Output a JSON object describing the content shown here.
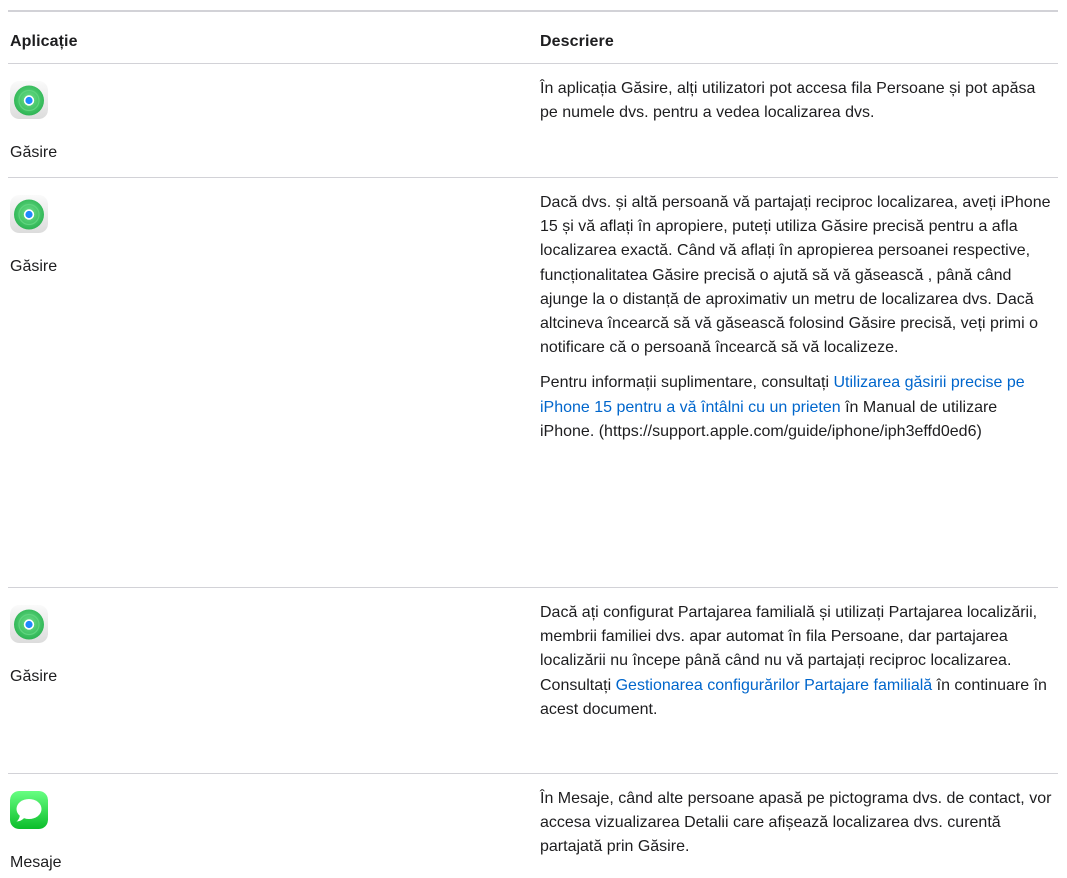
{
  "table": {
    "headers": {
      "app": "Aplicație",
      "description": "Descriere"
    },
    "rows": [
      {
        "app_name": "Găsire",
        "icon": "find-my-icon",
        "paragraphs": [
          {
            "text": "În aplicația Găsire, alți utilizatori pot accesa fila Persoane și pot apăsa pe numele dvs. pentru a vedea localizarea dvs."
          }
        ]
      },
      {
        "app_name": "Găsire",
        "icon": "find-my-icon",
        "paragraphs": [
          {
            "text": "Dacă dvs. și altă persoană vă partajați reciproc localizarea, aveți iPhone 15 și vă aflați în apropiere, puteți utiliza Găsire precisă pentru a afla localizarea exactă. Când vă aflați în apropierea persoanei respective, funcționalitatea Găsire precisă o ajută să vă găsească , până când ajunge la o distanță de aproximativ un metru de localizarea dvs. Dacă altcineva încearcă să vă găsească folosind Găsire precisă, veți primi o notificare că o persoană încearcă să vă localizeze."
          },
          {
            "before": "Pentru informații suplimentare, consultați ",
            "link": "Utilizarea găsirii precise pe iPhone 15 pentru a vă întâlni cu un prieten",
            "after": " în Manual de utilizare iPhone. (https://support.apple.com/guide/iphone/iph3effd0ed6)"
          }
        ]
      },
      {
        "app_name": "Găsire",
        "icon": "find-my-icon",
        "paragraphs": [
          {
            "before": "Dacă ați configurat Partajarea familială și utilizați Partajarea localizării, membrii familiei dvs. apar automat în fila Persoane, dar partajarea localizării nu începe până când nu vă partajați reciproc localizarea. Consultați ",
            "link": "Gestionarea configurărilor Partajare familială",
            "after": " în continuare în acest document."
          }
        ]
      },
      {
        "app_name": "Mesaje",
        "icon": "messages-icon",
        "paragraphs": [
          {
            "text": "În Mesaje, când alte persoane apasă pe pictograma dvs. de contact, vor accesa vizualizarea Detalii care afișează localizarea dvs. curentă partajată prin Găsire."
          }
        ]
      }
    ]
  },
  "colors": {
    "link": "#0066cc",
    "text": "#1d1d1f",
    "divider": "#d2d2d7",
    "find_my_green": "#34c759",
    "messages_green": "#30d158"
  }
}
